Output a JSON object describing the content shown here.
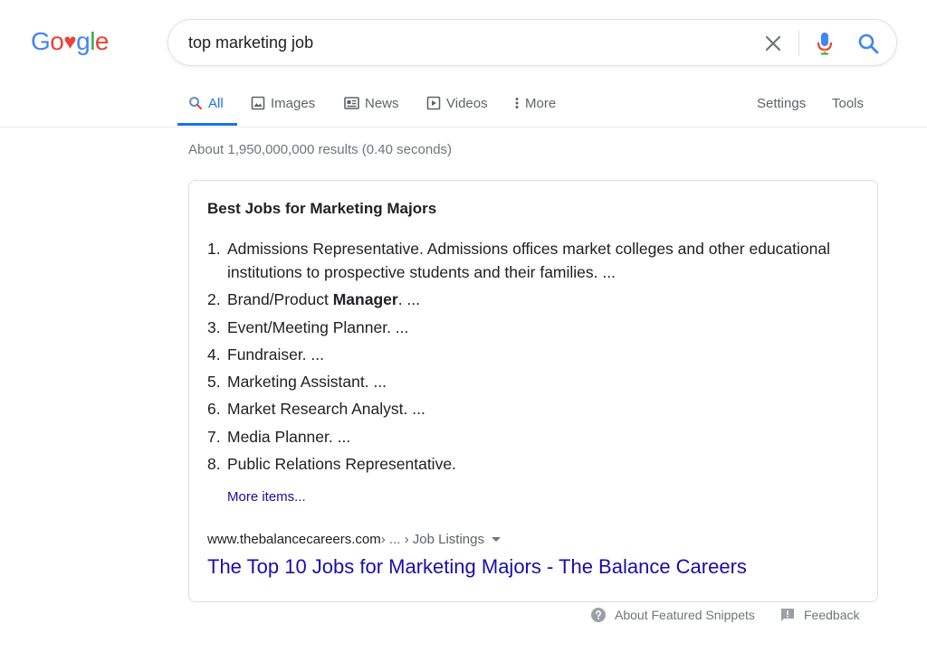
{
  "logo": {
    "letters": [
      {
        "char": "G",
        "color": "#4285F4"
      },
      {
        "char": "o",
        "color": "#EA4335"
      },
      {
        "char": "♥",
        "color": "#EA4335"
      },
      {
        "char": "g",
        "color": "#4285F4"
      },
      {
        "char": "l",
        "color": "#34A853"
      },
      {
        "char": "e",
        "color": "#EA4335"
      }
    ]
  },
  "search": {
    "query": "top marketing job",
    "clear_icon": "close-icon",
    "voice_icon": "mic-icon",
    "submit_icon": "search-icon"
  },
  "tabs": {
    "all": "All",
    "images": "Images",
    "news": "News",
    "videos": "Videos",
    "more": "More",
    "settings": "Settings",
    "tools": "Tools",
    "active": "All"
  },
  "results": {
    "stats": "About 1,950,000,000 results (0.40 seconds)"
  },
  "snippet": {
    "title": "Best Jobs for Marketing Majors",
    "items": [
      {
        "num": "1.",
        "text": "Admissions Representative. Admissions offices market colleges and other educational institutions to prospective students and their families. ..."
      },
      {
        "num": "2.",
        "pre": "Brand/Product ",
        "bold": "Manager",
        "post": ". ..."
      },
      {
        "num": "3.",
        "text": "Event/Meeting Planner. ..."
      },
      {
        "num": "4.",
        "text": "Fundraiser. ..."
      },
      {
        "num": "5.",
        "text": "Marketing Assistant. ..."
      },
      {
        "num": "6.",
        "text": "Market Research Analyst. ..."
      },
      {
        "num": "7.",
        "text": "Media Planner. ..."
      },
      {
        "num": "8.",
        "text": "Public Relations Representative."
      }
    ],
    "more_items": "More items...",
    "cite_domain": "www.thebalancecareers.com",
    "cite_path": " › ... › Job Listings",
    "link_title": "The Top 10 Jobs for Marketing Majors - The Balance Careers"
  },
  "footer": {
    "about_snippets": "About Featured Snippets",
    "feedback": "Feedback"
  },
  "colors": {
    "accent_blue": "#1a73e8",
    "link_blue": "#1a0dab",
    "text_gray": "#70757a"
  }
}
